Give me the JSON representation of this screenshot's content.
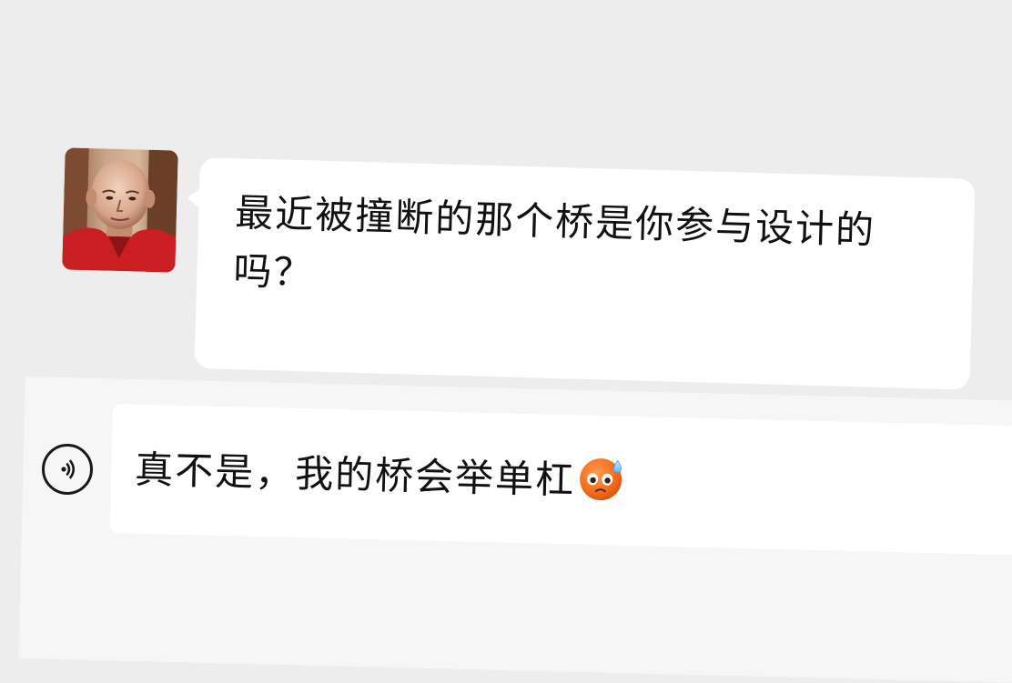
{
  "chat": {
    "incoming_message": "最近被撞断的那个桥是你参与设计的吗？"
  },
  "input": {
    "text": "真不是，我的桥会举单杠",
    "emoji": "cold-sweat-face"
  },
  "icons": {
    "avatar": "bald-man-avatar",
    "voice": "voice-toggle-icon"
  },
  "colors": {
    "background": "#ededed",
    "bubble": "#ffffff",
    "input_bar": "#f6f6f6",
    "text": "#111111",
    "emoji_orange": "#f26a1b"
  }
}
